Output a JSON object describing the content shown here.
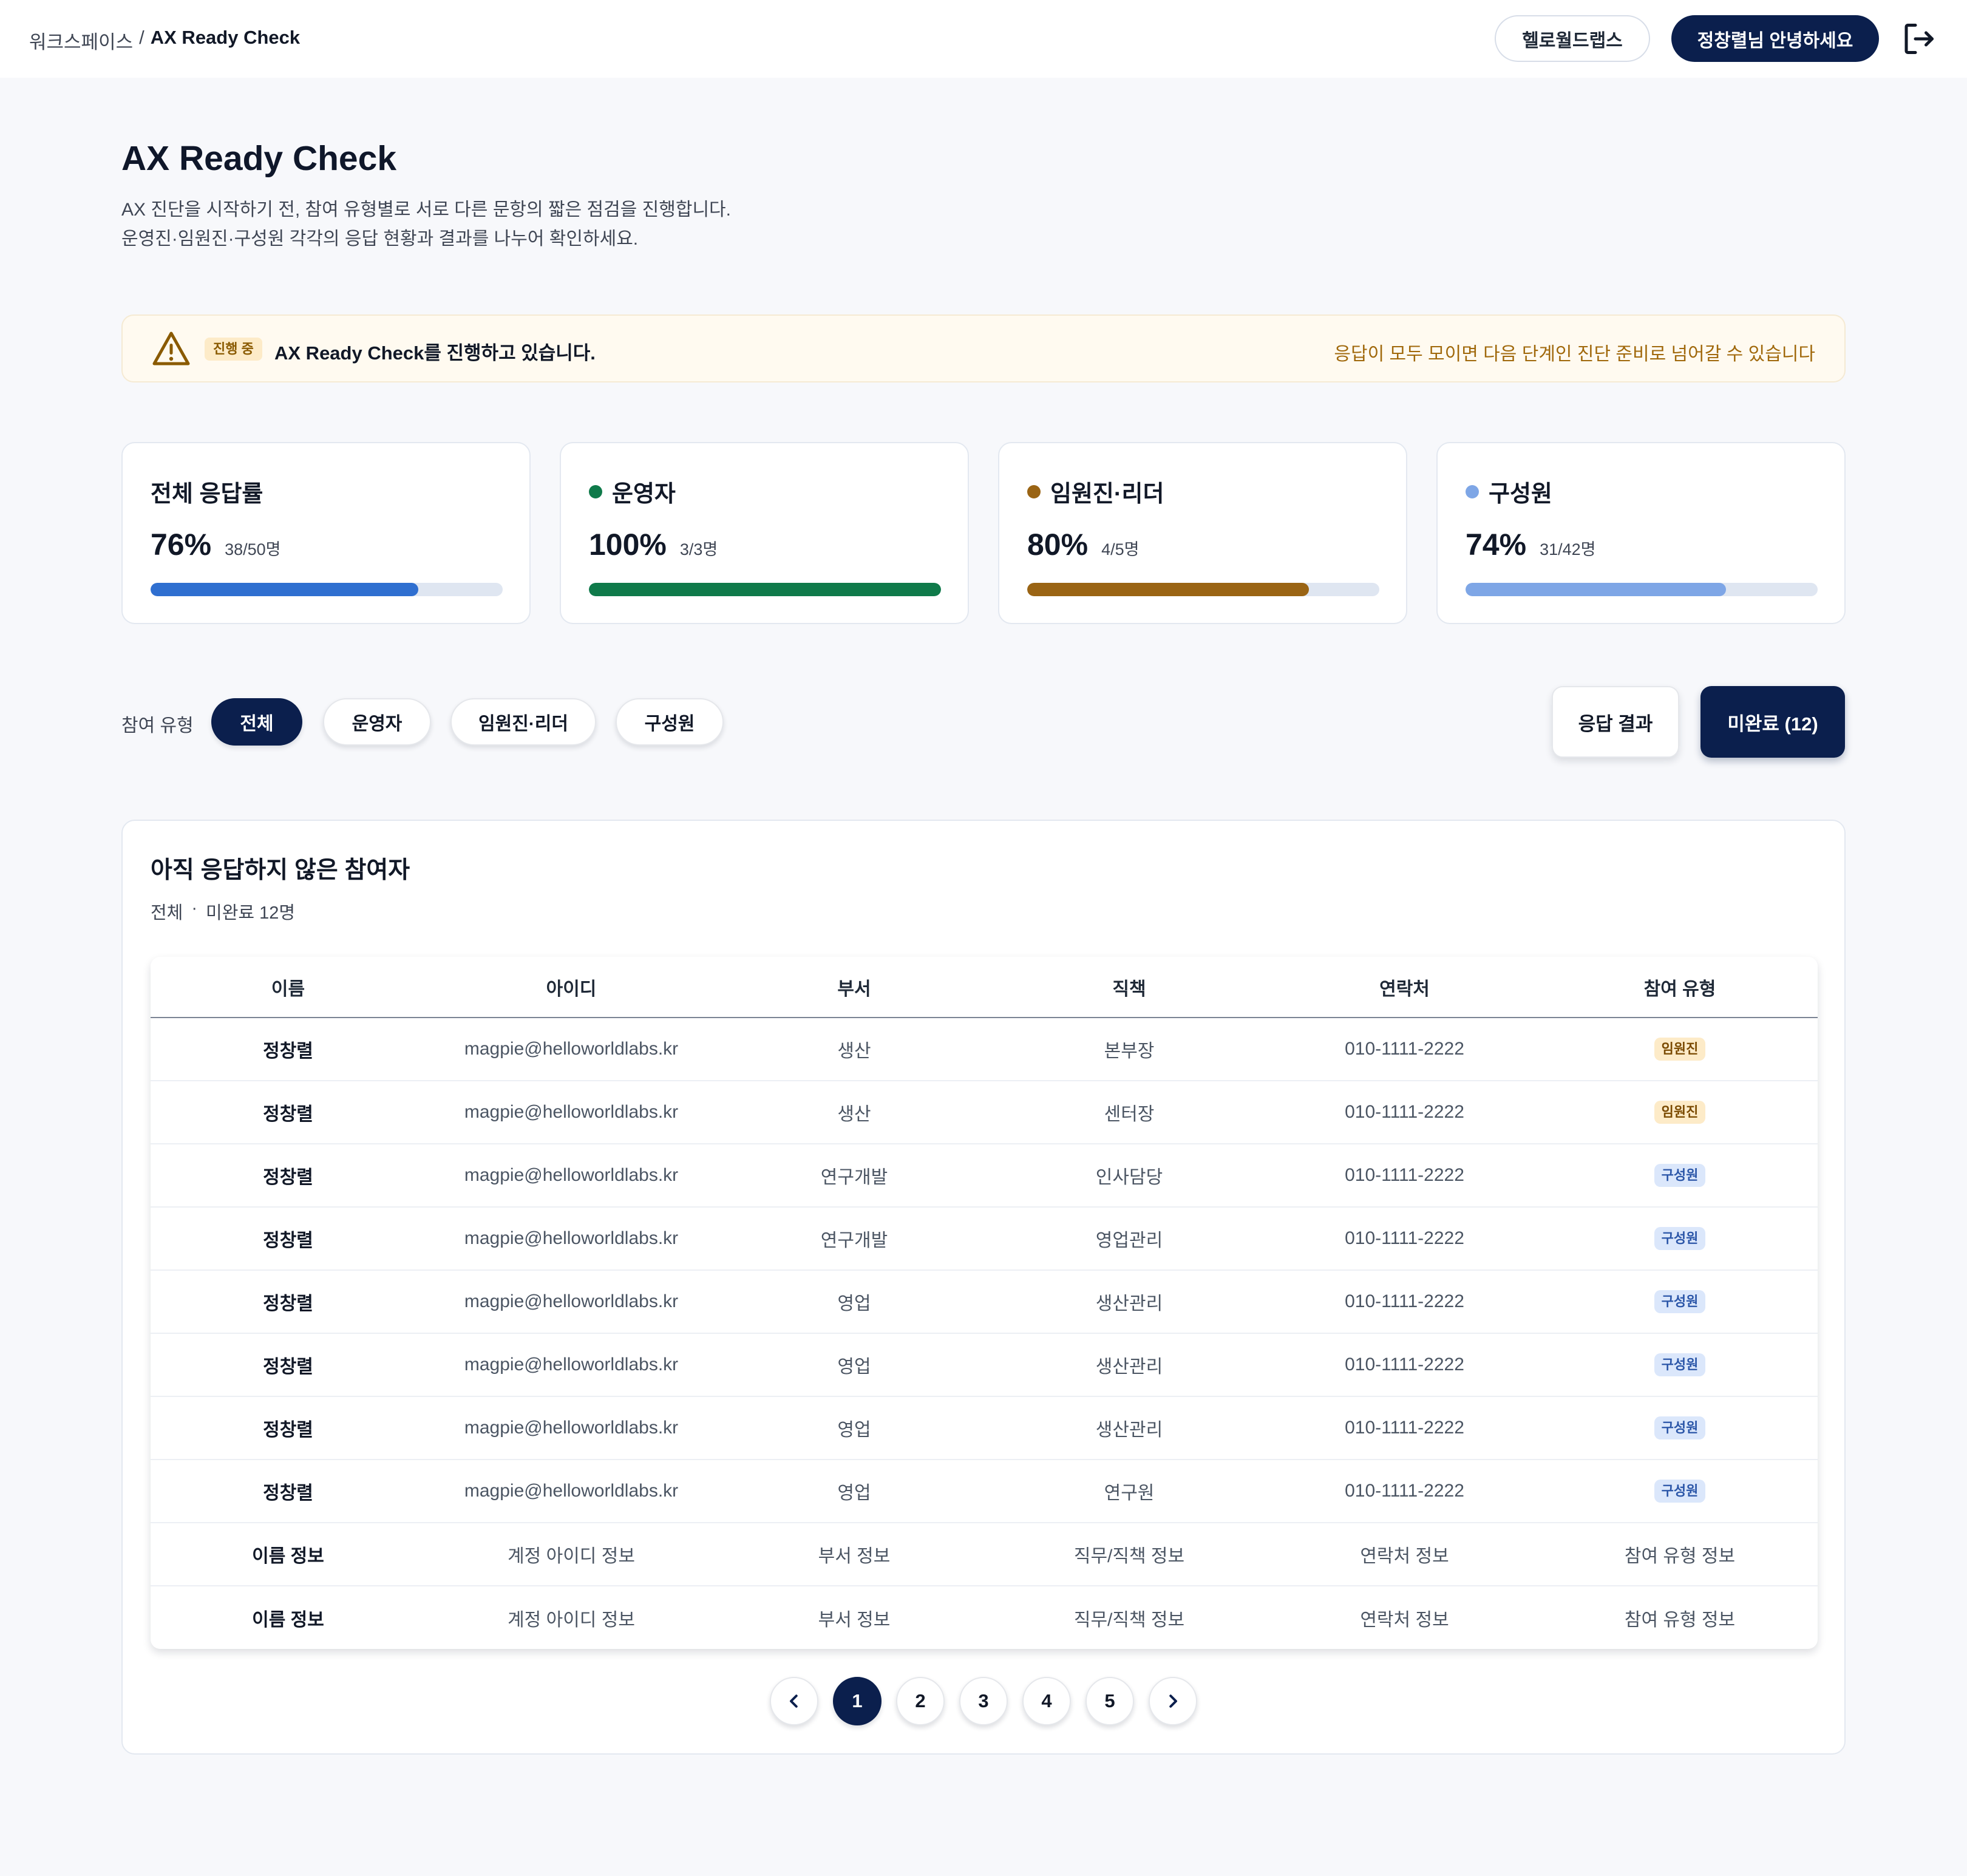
{
  "header": {
    "breadcrumb_workspace": "워크스페이스",
    "breadcrumb_separator": "/",
    "breadcrumb_current": "AX Ready Check",
    "org_label": "헬로월드랩스",
    "user_greeting": "정창렬님 안녕하세요",
    "logout_icon": "logout-icon"
  },
  "page": {
    "title": "AX Ready Check",
    "desc_line1": "AX 진단을 시작하기 전, 참여 유형별로 서로 다른 문항의 짧은 점검을 진행합니다.",
    "desc_line2": "운영진·임원진·구성원 각각의 응답 현황과 결과를 나누어 확인하세요."
  },
  "alert": {
    "icon": "warning-icon",
    "badge": "진행 중",
    "message": "AX Ready Check를 진행하고 있습니다.",
    "hint": "응답이 모두 모이면 다음 단계인 진단 준비로 넘어갈 수 있습니다"
  },
  "stats": [
    {
      "title": "전체 응답률",
      "percent": "76%",
      "count": "38/50명",
      "progress": 0.76,
      "color": "#2f6fd0",
      "dot": ""
    },
    {
      "title": "운영자",
      "percent": "100%",
      "count": "3/3명",
      "progress": 1.0,
      "color": "#0f7a4a",
      "dot": "#0f7a4a"
    },
    {
      "title": "임원진·리더",
      "percent": "80%",
      "count": "4/5명",
      "progress": 0.8,
      "color": "#9a6414",
      "dot": "#9a6414"
    },
    {
      "title": "구성원",
      "percent": "74%",
      "count": "31/42명",
      "progress": 0.74,
      "color": "#7ea6e6",
      "dot": "#7ea6e6"
    }
  ],
  "filter": {
    "label": "참여 유형",
    "chips": [
      "전체",
      "운영자",
      "임원진·리더",
      "구성원"
    ],
    "active_index": 0,
    "result_button": "응답 결과",
    "pending_button": "미완료 (12)"
  },
  "panel": {
    "title": "아직 응답하지 않은 참여자",
    "sub_scope": "전체",
    "sub_dot": "·",
    "sub_count": "미완료 12명"
  },
  "table": {
    "columns": [
      "이름",
      "아이디",
      "부서",
      "직책",
      "연락처",
      "참여 유형"
    ],
    "rows": [
      {
        "name": "정창렬",
        "id": "magpie@helloworldlabs.kr",
        "dept": "생산",
        "position": "본부장",
        "phone": "010-1111-2222",
        "type": "임원진",
        "type_kind": "exec"
      },
      {
        "name": "정창렬",
        "id": "magpie@helloworldlabs.kr",
        "dept": "생산",
        "position": "센터장",
        "phone": "010-1111-2222",
        "type": "임원진",
        "type_kind": "exec"
      },
      {
        "name": "정창렬",
        "id": "magpie@helloworldlabs.kr",
        "dept": "연구개발",
        "position": "인사담당",
        "phone": "010-1111-2222",
        "type": "구성원",
        "type_kind": "member"
      },
      {
        "name": "정창렬",
        "id": "magpie@helloworldlabs.kr",
        "dept": "연구개발",
        "position": "영업관리",
        "phone": "010-1111-2222",
        "type": "구성원",
        "type_kind": "member"
      },
      {
        "name": "정창렬",
        "id": "magpie@helloworldlabs.kr",
        "dept": "영업",
        "position": "생산관리",
        "phone": "010-1111-2222",
        "type": "구성원",
        "type_kind": "member"
      },
      {
        "name": "정창렬",
        "id": "magpie@helloworldlabs.kr",
        "dept": "영업",
        "position": "생산관리",
        "phone": "010-1111-2222",
        "type": "구성원",
        "type_kind": "member"
      },
      {
        "name": "정창렬",
        "id": "magpie@helloworldlabs.kr",
        "dept": "영업",
        "position": "생산관리",
        "phone": "010-1111-2222",
        "type": "구성원",
        "type_kind": "member"
      },
      {
        "name": "정창렬",
        "id": "magpie@helloworldlabs.kr",
        "dept": "영업",
        "position": "연구원",
        "phone": "010-1111-2222",
        "type": "구성원",
        "type_kind": "member"
      },
      {
        "name": "이름 정보",
        "id": "계정 아이디 정보",
        "dept": "부서 정보",
        "position": "직무/직책 정보",
        "phone": "연락처 정보",
        "type": "참여 유형 정보",
        "type_kind": "text"
      },
      {
        "name": "이름 정보",
        "id": "계정 아이디 정보",
        "dept": "부서 정보",
        "position": "직무/직책 정보",
        "phone": "연락처 정보",
        "type": "참여 유형 정보",
        "type_kind": "text"
      }
    ]
  },
  "pagination": {
    "prev_icon": "chevron-left-icon",
    "next_icon": "chevron-right-icon",
    "pages": [
      "1",
      "2",
      "3",
      "4",
      "5"
    ],
    "current": "1"
  }
}
